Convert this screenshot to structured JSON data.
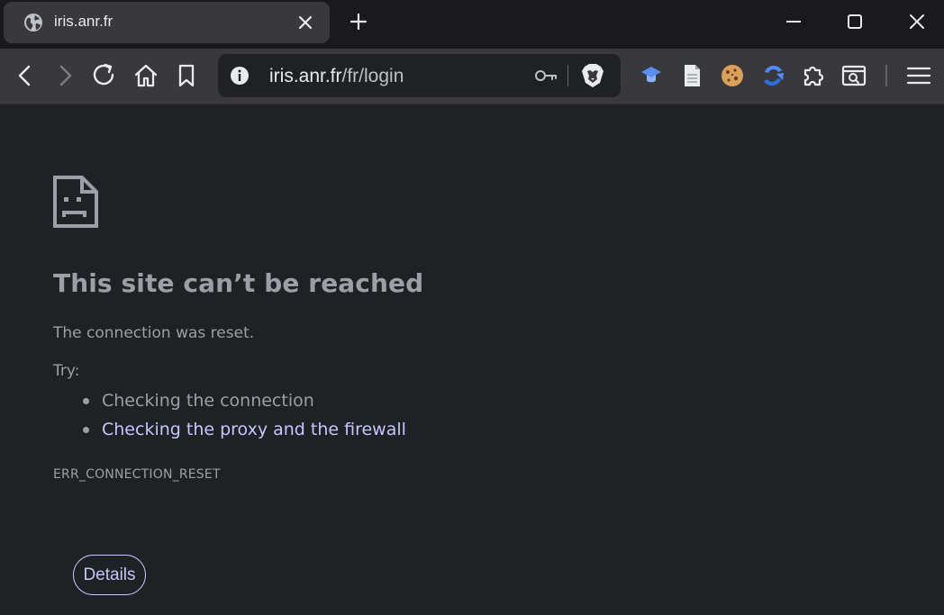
{
  "tab": {
    "title": "iris.anr.fr",
    "favicon": "globe-icon"
  },
  "toolbar": {
    "url_host": "iris.anr.fr",
    "url_path": "/fr/login",
    "icons": [
      "back-icon",
      "forward-icon",
      "reload-icon",
      "home-icon",
      "bookmark-icon",
      "site-info-icon",
      "password-key-icon",
      "brave-shield-icon",
      "ublock-extension-icon",
      "page-extension-icon",
      "cookie-extension-icon",
      "sync-extension-icon",
      "extensions-puzzle-icon",
      "reading-list-icon",
      "menu-icon"
    ]
  },
  "error": {
    "heading": "This site can’t be reached",
    "message": "The connection was reset.",
    "try_label": "Try:",
    "suggestions": [
      "Checking the connection",
      "Checking the proxy and the firewall"
    ],
    "code": "ERR_CONNECTION_RESET",
    "details_label": "Details"
  },
  "colors": {
    "page_bg": "#202124",
    "text": "#9aa0a6",
    "link": "#c4c7ff",
    "toolbar_bg": "#38383d"
  }
}
